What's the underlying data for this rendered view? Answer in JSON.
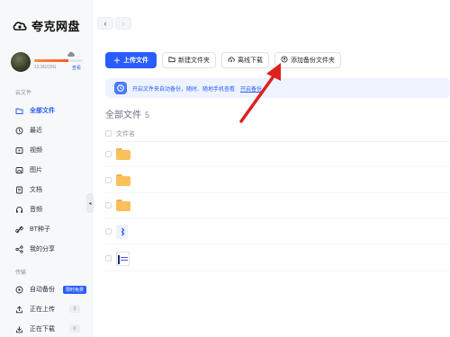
{
  "app": {
    "title": "夸克网盘"
  },
  "user": {
    "storage_text": "13.9G/20G",
    "storage_used_fraction": 0.695,
    "view_label": "查看"
  },
  "sidebar": {
    "section_cloud": "云文件",
    "items": [
      {
        "label": "全部文件",
        "icon": "folder-outline-icon",
        "active": true
      },
      {
        "label": "最近",
        "icon": "clock-icon"
      },
      {
        "label": "视频",
        "icon": "video-icon"
      },
      {
        "label": "图片",
        "icon": "image-icon"
      },
      {
        "label": "文档",
        "icon": "document-icon"
      },
      {
        "label": "音频",
        "icon": "headphones-icon"
      },
      {
        "label": "BT种子",
        "icon": "link-icon"
      },
      {
        "label": "我的分享",
        "icon": "share-icon"
      }
    ],
    "section_transfer": "传输",
    "transfer": [
      {
        "label": "自动备份",
        "icon": "backup-icon",
        "badge": "限时免费"
      },
      {
        "label": "正在上传",
        "icon": "upload-icon",
        "count": "0"
      },
      {
        "label": "正在下载",
        "icon": "download-icon",
        "count": "0"
      }
    ]
  },
  "toolbar": {
    "upload": "上传文件",
    "new_folder": "新建文件夹",
    "offline_download": "离线下载",
    "add_backup": "添加备份文件夹"
  },
  "banner": {
    "text": "开启文件夹自动备份，随时、随地手机查看",
    "link": "开启备份"
  },
  "main": {
    "title": "全部文件",
    "count": "5",
    "column_name": "文件名"
  },
  "files": [
    {
      "type": "folder"
    },
    {
      "type": "folder"
    },
    {
      "type": "folder"
    },
    {
      "type": "doc"
    },
    {
      "type": "image"
    }
  ],
  "colors": {
    "accent": "#2b5cff",
    "arrow": "#e02020",
    "folder": "#f8c15c"
  }
}
